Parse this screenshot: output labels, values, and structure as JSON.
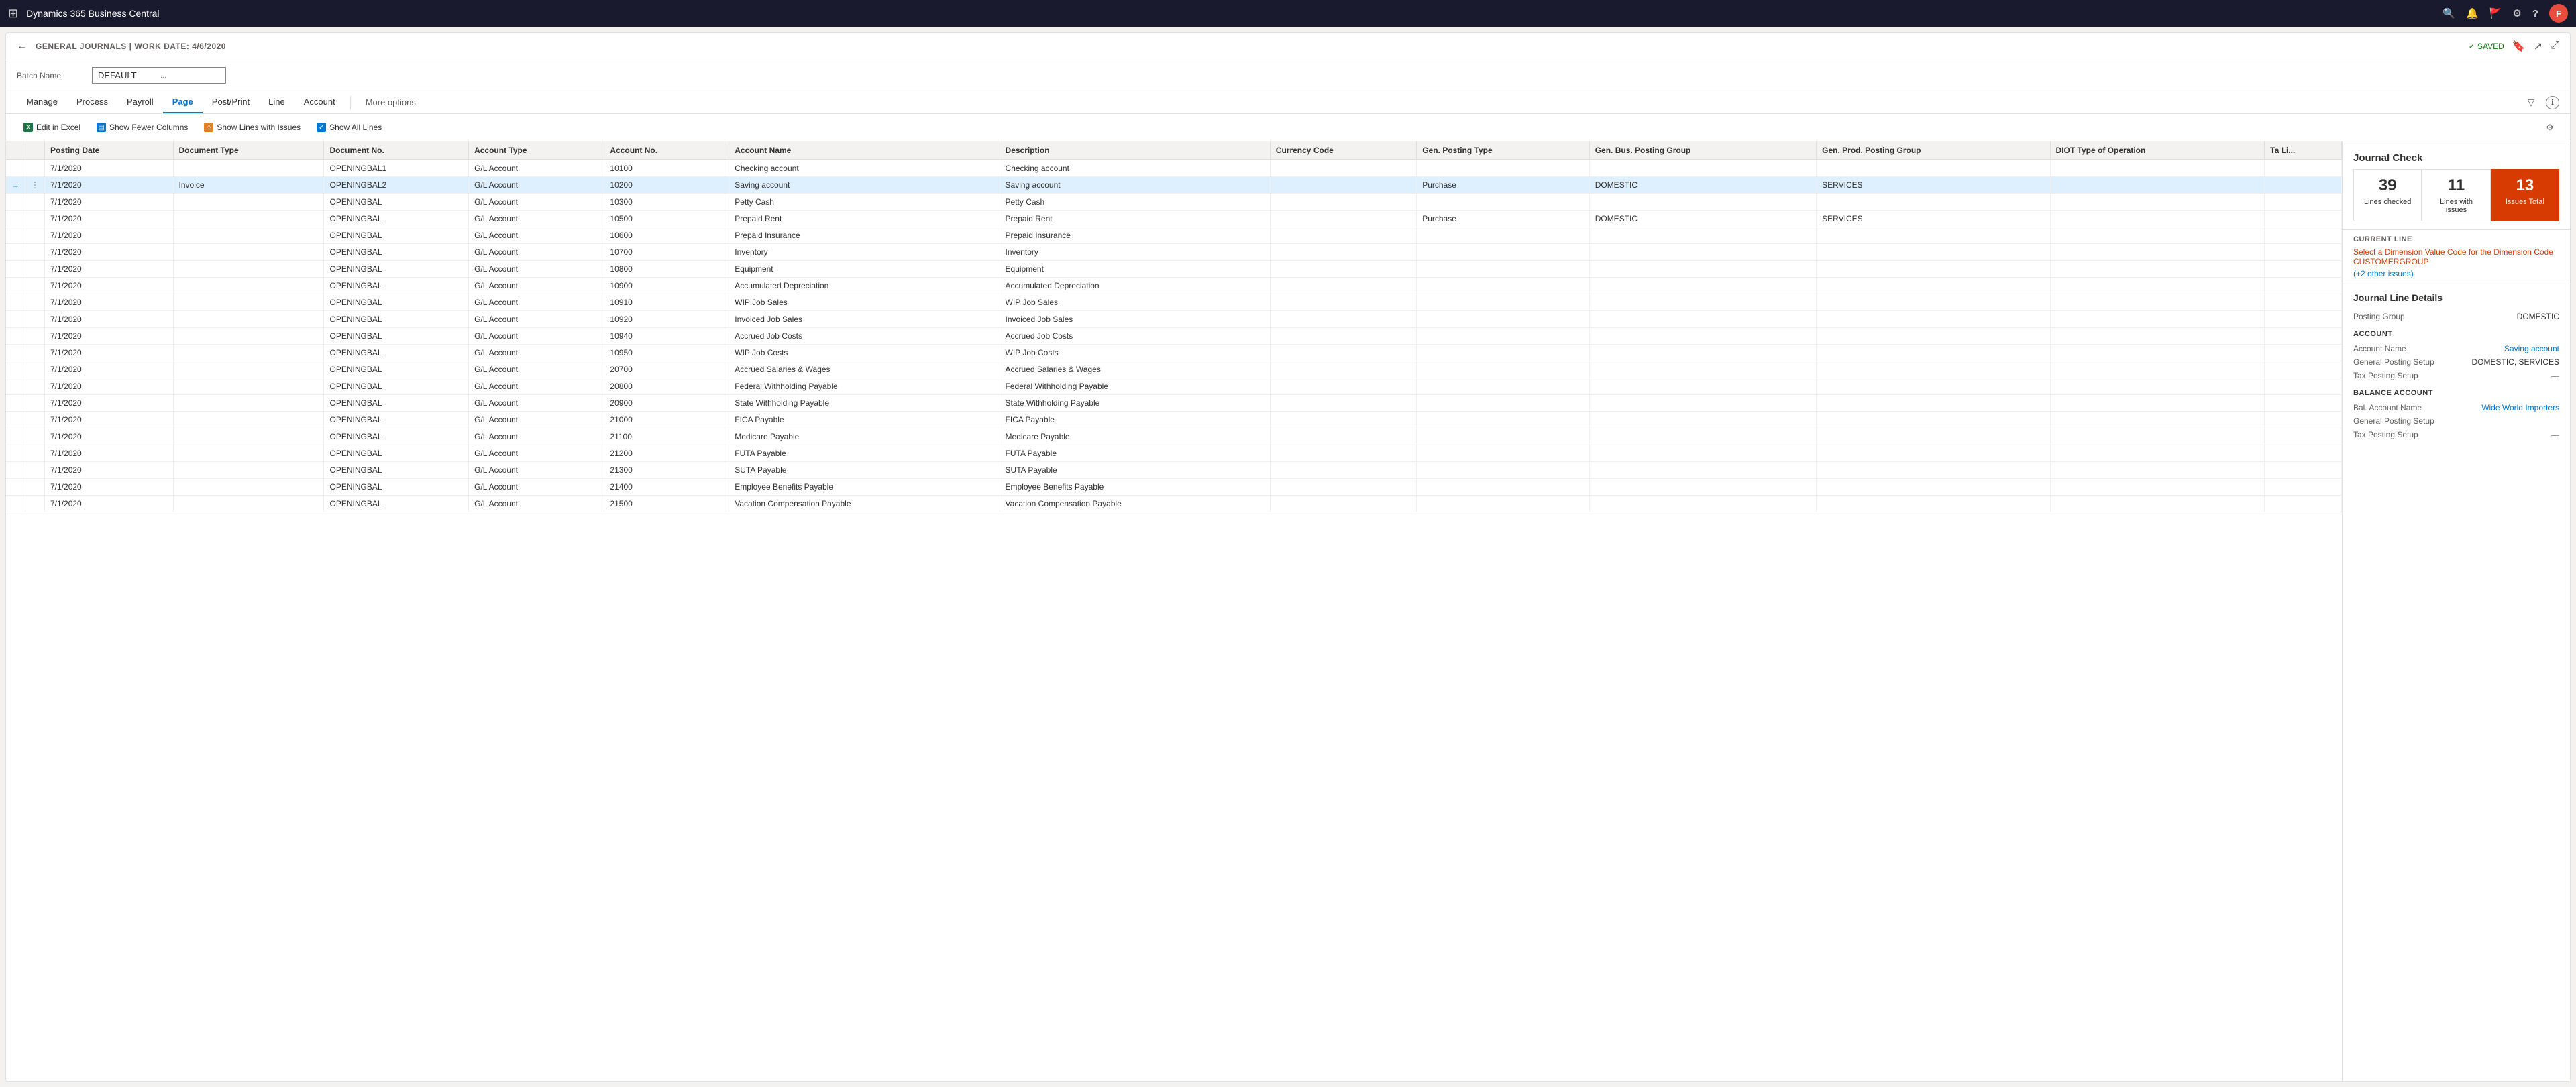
{
  "topbar": {
    "grid_icon": "⊞",
    "app_name": "Dynamics 365 Business Central",
    "search_icon": "🔍",
    "bell_icon": "🔔",
    "flag_icon": "🚩",
    "settings_icon": "⚙",
    "help_icon": "?",
    "avatar_label": "F"
  },
  "page_header": {
    "back_label": "←",
    "title": "GENERAL JOURNALS | WORK DATE: 4/6/2020",
    "saved_label": "✓ SAVED",
    "bookmark_icon": "🔖",
    "share_icon": "↗",
    "fullscreen_icon": "⤢"
  },
  "batch": {
    "label": "Batch Name",
    "value": "DEFAULT",
    "ellipsis": "..."
  },
  "ribbon": {
    "tabs": [
      {
        "id": "manage",
        "label": "Manage",
        "active": false
      },
      {
        "id": "process",
        "label": "Process",
        "active": false
      },
      {
        "id": "payroll",
        "label": "Payroll",
        "active": false
      },
      {
        "id": "page",
        "label": "Page",
        "active": true
      },
      {
        "id": "postprint",
        "label": "Post/Print",
        "active": false
      },
      {
        "id": "line",
        "label": "Line",
        "active": false
      },
      {
        "id": "account",
        "label": "Account",
        "active": false
      }
    ],
    "more_options": "More options",
    "filter_icon": "▽",
    "info_icon": "ℹ"
  },
  "toolbar": {
    "edit_excel": "Edit in Excel",
    "show_fewer_columns": "Show Fewer Columns",
    "show_lines_issues": "Show Lines with Issues",
    "show_all_lines": "Show All Lines"
  },
  "table": {
    "columns": [
      "Posting Date",
      "Document Type",
      "Document No.",
      "Account Type",
      "Account No.",
      "Account Name",
      "Description",
      "Currency Code",
      "Gen. Posting Type",
      "Gen. Bus. Posting Group",
      "Gen. Prod. Posting Group",
      "DIOT Type of Operation",
      "Ta Li..."
    ],
    "rows": [
      {
        "posting_date": "7/1/2020",
        "doc_type": "",
        "doc_no": "OPENINGBAL1",
        "acct_type": "G/L Account",
        "acct_no": "10100",
        "acct_name": "Checking account",
        "description": "Checking account",
        "currency": "",
        "gen_post_type": "",
        "gen_bus_group": "",
        "gen_prod_group": "",
        "diot": "",
        "selected": false,
        "arrow": false,
        "dots": false
      },
      {
        "posting_date": "7/1/2020",
        "doc_type": "Invoice",
        "doc_no": "OPENINGBAL2",
        "acct_type": "G/L Account",
        "acct_no": "10200",
        "acct_name": "Saving account",
        "description": "Saving account",
        "currency": "",
        "gen_post_type": "Purchase",
        "gen_bus_group": "DOMESTIC",
        "gen_prod_group": "SERVICES",
        "diot": "",
        "selected": true,
        "arrow": true,
        "dots": true
      },
      {
        "posting_date": "7/1/2020",
        "doc_type": "",
        "doc_no": "OPENINGBAL",
        "acct_type": "G/L Account",
        "acct_no": "10300",
        "acct_name": "Petty Cash",
        "description": "Petty Cash",
        "currency": "",
        "gen_post_type": "",
        "gen_bus_group": "",
        "gen_prod_group": "",
        "diot": "",
        "selected": false,
        "arrow": false,
        "dots": false
      },
      {
        "posting_date": "7/1/2020",
        "doc_type": "",
        "doc_no": "OPENINGBAL",
        "acct_type": "G/L Account",
        "acct_no": "10500",
        "acct_name": "Prepaid Rent",
        "description": "Prepaid Rent",
        "currency": "",
        "gen_post_type": "Purchase",
        "gen_bus_group": "DOMESTIC",
        "gen_prod_group": "SERVICES",
        "diot": "",
        "selected": false,
        "arrow": false,
        "dots": false
      },
      {
        "posting_date": "7/1/2020",
        "doc_type": "",
        "doc_no": "OPENINGBAL",
        "acct_type": "G/L Account",
        "acct_no": "10600",
        "acct_name": "Prepaid Insurance",
        "description": "Prepaid Insurance",
        "currency": "",
        "gen_post_type": "",
        "gen_bus_group": "",
        "gen_prod_group": "",
        "diot": "",
        "selected": false,
        "arrow": false,
        "dots": false
      },
      {
        "posting_date": "7/1/2020",
        "doc_type": "",
        "doc_no": "OPENINGBAL",
        "acct_type": "G/L Account",
        "acct_no": "10700",
        "acct_name": "Inventory",
        "description": "Inventory",
        "currency": "",
        "gen_post_type": "",
        "gen_bus_group": "",
        "gen_prod_group": "",
        "diot": "",
        "selected": false,
        "arrow": false,
        "dots": false
      },
      {
        "posting_date": "7/1/2020",
        "doc_type": "",
        "doc_no": "OPENINGBAL",
        "acct_type": "G/L Account",
        "acct_no": "10800",
        "acct_name": "Equipment",
        "description": "Equipment",
        "currency": "",
        "gen_post_type": "",
        "gen_bus_group": "",
        "gen_prod_group": "",
        "diot": "",
        "selected": false,
        "arrow": false,
        "dots": false
      },
      {
        "posting_date": "7/1/2020",
        "doc_type": "",
        "doc_no": "OPENINGBAL",
        "acct_type": "G/L Account",
        "acct_no": "10900",
        "acct_name": "Accumulated Depreciation",
        "description": "Accumulated Depreciation",
        "currency": "",
        "gen_post_type": "",
        "gen_bus_group": "",
        "gen_prod_group": "",
        "diot": "",
        "selected": false,
        "arrow": false,
        "dots": false
      },
      {
        "posting_date": "7/1/2020",
        "doc_type": "",
        "doc_no": "OPENINGBAL",
        "acct_type": "G/L Account",
        "acct_no": "10910",
        "acct_name": "WIP Job Sales",
        "description": "WIP Job Sales",
        "currency": "",
        "gen_post_type": "",
        "gen_bus_group": "",
        "gen_prod_group": "",
        "diot": "",
        "selected": false,
        "arrow": false,
        "dots": false
      },
      {
        "posting_date": "7/1/2020",
        "doc_type": "",
        "doc_no": "OPENINGBAL",
        "acct_type": "G/L Account",
        "acct_no": "10920",
        "acct_name": "Invoiced Job Sales",
        "description": "Invoiced Job Sales",
        "currency": "",
        "gen_post_type": "",
        "gen_bus_group": "",
        "gen_prod_group": "",
        "diot": "",
        "selected": false,
        "arrow": false,
        "dots": false
      },
      {
        "posting_date": "7/1/2020",
        "doc_type": "",
        "doc_no": "OPENINGBAL",
        "acct_type": "G/L Account",
        "acct_no": "10940",
        "acct_name": "Accrued Job Costs",
        "description": "Accrued Job Costs",
        "currency": "",
        "gen_post_type": "",
        "gen_bus_group": "",
        "gen_prod_group": "",
        "diot": "",
        "selected": false,
        "arrow": false,
        "dots": false
      },
      {
        "posting_date": "7/1/2020",
        "doc_type": "",
        "doc_no": "OPENINGBAL",
        "acct_type": "G/L Account",
        "acct_no": "10950",
        "acct_name": "WIP Job Costs",
        "description": "WIP Job Costs",
        "currency": "",
        "gen_post_type": "",
        "gen_bus_group": "",
        "gen_prod_group": "",
        "diot": "",
        "selected": false,
        "arrow": false,
        "dots": false
      },
      {
        "posting_date": "7/1/2020",
        "doc_type": "",
        "doc_no": "OPENINGBAL",
        "acct_type": "G/L Account",
        "acct_no": "20700",
        "acct_name": "Accrued Salaries & Wages",
        "description": "Accrued Salaries & Wages",
        "currency": "",
        "gen_post_type": "",
        "gen_bus_group": "",
        "gen_prod_group": "",
        "diot": "",
        "selected": false,
        "arrow": false,
        "dots": false
      },
      {
        "posting_date": "7/1/2020",
        "doc_type": "",
        "doc_no": "OPENINGBAL",
        "acct_type": "G/L Account",
        "acct_no": "20800",
        "acct_name": "Federal Withholding Payable",
        "description": "Federal Withholding Payable",
        "currency": "",
        "gen_post_type": "",
        "gen_bus_group": "",
        "gen_prod_group": "",
        "diot": "",
        "selected": false,
        "arrow": false,
        "dots": false
      },
      {
        "posting_date": "7/1/2020",
        "doc_type": "",
        "doc_no": "OPENINGBAL",
        "acct_type": "G/L Account",
        "acct_no": "20900",
        "acct_name": "State Withholding Payable",
        "description": "State Withholding Payable",
        "currency": "",
        "gen_post_type": "",
        "gen_bus_group": "",
        "gen_prod_group": "",
        "diot": "",
        "selected": false,
        "arrow": false,
        "dots": false
      },
      {
        "posting_date": "7/1/2020",
        "doc_type": "",
        "doc_no": "OPENINGBAL",
        "acct_type": "G/L Account",
        "acct_no": "21000",
        "acct_name": "FICA Payable",
        "description": "FICA Payable",
        "currency": "",
        "gen_post_type": "",
        "gen_bus_group": "",
        "gen_prod_group": "",
        "diot": "",
        "selected": false,
        "arrow": false,
        "dots": false
      },
      {
        "posting_date": "7/1/2020",
        "doc_type": "",
        "doc_no": "OPENINGBAL",
        "acct_type": "G/L Account",
        "acct_no": "21100",
        "acct_name": "Medicare Payable",
        "description": "Medicare Payable",
        "currency": "",
        "gen_post_type": "",
        "gen_bus_group": "",
        "gen_prod_group": "",
        "diot": "",
        "selected": false,
        "arrow": false,
        "dots": false
      },
      {
        "posting_date": "7/1/2020",
        "doc_type": "",
        "doc_no": "OPENINGBAL",
        "acct_type": "G/L Account",
        "acct_no": "21200",
        "acct_name": "FUTA Payable",
        "description": "FUTA Payable",
        "currency": "",
        "gen_post_type": "",
        "gen_bus_group": "",
        "gen_prod_group": "",
        "diot": "",
        "selected": false,
        "arrow": false,
        "dots": false
      },
      {
        "posting_date": "7/1/2020",
        "doc_type": "",
        "doc_no": "OPENINGBAL",
        "acct_type": "G/L Account",
        "acct_no": "21300",
        "acct_name": "SUTA Payable",
        "description": "SUTA Payable",
        "currency": "",
        "gen_post_type": "",
        "gen_bus_group": "",
        "gen_prod_group": "",
        "diot": "",
        "selected": false,
        "arrow": false,
        "dots": false
      },
      {
        "posting_date": "7/1/2020",
        "doc_type": "",
        "doc_no": "OPENINGBAL",
        "acct_type": "G/L Account",
        "acct_no": "21400",
        "acct_name": "Employee Benefits Payable",
        "description": "Employee Benefits Payable",
        "currency": "",
        "gen_post_type": "",
        "gen_bus_group": "",
        "gen_prod_group": "",
        "diot": "",
        "selected": false,
        "arrow": false,
        "dots": false
      },
      {
        "posting_date": "7/1/2020",
        "doc_type": "",
        "doc_no": "OPENINGBAL",
        "acct_type": "G/L Account",
        "acct_no": "21500",
        "acct_name": "Vacation Compensation Payable",
        "description": "Vacation Compensation Payable",
        "currency": "",
        "gen_post_type": "",
        "gen_bus_group": "",
        "gen_prod_group": "",
        "diot": "",
        "selected": false,
        "arrow": false,
        "dots": false
      }
    ]
  },
  "right_panel": {
    "title": "Journal Check",
    "cards": [
      {
        "id": "checked",
        "number": "39",
        "label": "Lines checked",
        "is_issues": false
      },
      {
        "id": "with_issues",
        "number": "11",
        "label": "Lines with issues",
        "is_issues": false
      },
      {
        "id": "total",
        "number": "13",
        "label": "Issues Total",
        "is_issues": true
      }
    ],
    "current_line_label": "CURRENT LINE",
    "current_line_error": "Select a Dimension Value Code for the Dimension Code CUSTOMERGROUP",
    "more_issues_label": "(+2 other issues)",
    "journal_line_details_title": "Journal Line Details",
    "posting_group_label": "Posting Group",
    "posting_group_value": "DOMESTIC",
    "account_section": "ACCOUNT",
    "account_name_label": "Account Name",
    "account_name_value": "Saving account",
    "gen_posting_setup_label": "General Posting Setup",
    "gen_posting_setup_value": "DOMESTIC, SERVICES",
    "tax_posting_setup_label": "Tax Posting Setup",
    "tax_posting_setup_value": "—",
    "balance_account_section": "BALANCE ACCOUNT",
    "bal_account_name_label": "Bal. Account Name",
    "bal_account_name_value": "Wide World Importers",
    "bal_gen_posting_label": "General Posting Setup",
    "bal_gen_posting_value": "",
    "bal_tax_posting_label": "Tax Posting Setup",
    "bal_tax_posting_value": "—"
  }
}
